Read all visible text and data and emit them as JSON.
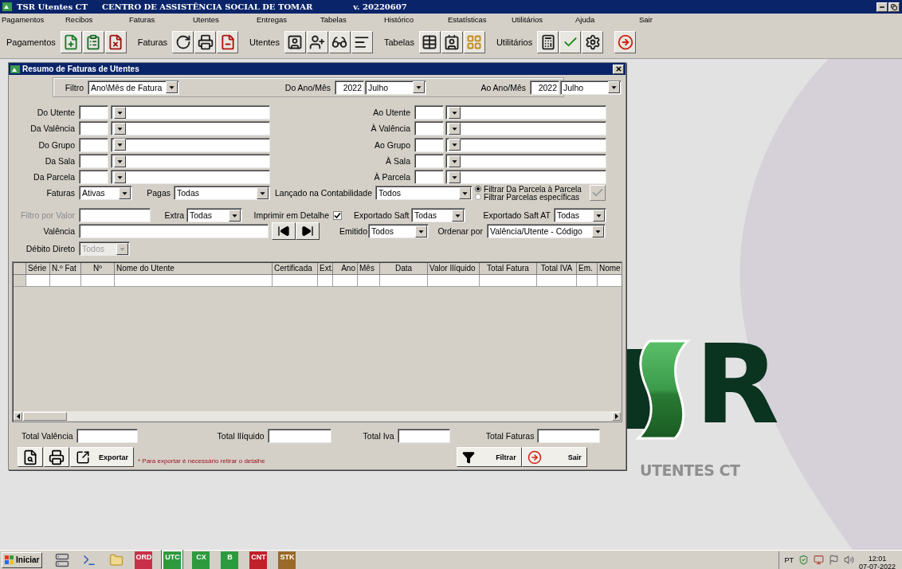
{
  "title_bar": {
    "app": "TSR Utentes CT",
    "organization": "CENTRO DE ASSISTÊNCIA SOCIAL DE TOMAR",
    "version": "v. 20220607"
  },
  "menu": [
    "Pagamentos",
    "Recibos",
    "Faturas",
    "Utentes",
    "Entregas",
    "Tabelas",
    "Histórico",
    "Estatísticas",
    "Utilitários",
    "Ajuda",
    "Sair"
  ],
  "toolbar": [
    {
      "label": "Pagamentos",
      "buttons": [
        {
          "kind": "new-doc"
        },
        {
          "kind": "checklist"
        },
        {
          "kind": "cancel-doc"
        }
      ]
    },
    {
      "label": "Faturas",
      "buttons": [
        {
          "kind": "refresh"
        },
        {
          "kind": "print"
        },
        {
          "kind": "void-doc"
        }
      ]
    },
    {
      "label": "Utentes",
      "buttons": [
        {
          "kind": "user-card"
        },
        {
          "kind": "user-add"
        },
        {
          "kind": "glasses"
        },
        {
          "kind": "list"
        }
      ]
    },
    {
      "label": "Tabelas",
      "buttons": [
        {
          "kind": "table"
        },
        {
          "kind": "users"
        },
        {
          "kind": "grid"
        }
      ]
    },
    {
      "label": "Utilitários",
      "buttons": [
        {
          "kind": "calculator"
        },
        {
          "kind": "check"
        },
        {
          "kind": "settings"
        }
      ]
    },
    {
      "buttons": [
        {
          "kind": "exit"
        }
      ]
    }
  ],
  "dialog": {
    "title": "Resumo de Faturas de Utentes",
    "period": {
      "filter_label": "Filtro",
      "filter_value": "Ano\\Mês de Fatura",
      "from_label": "Do Ano/Mês",
      "from_year": "2022",
      "from_month": "Julho",
      "to_label": "Ao Ano/Mês",
      "to_year": "2022",
      "to_month": "Julho"
    },
    "ranges": [
      {
        "from_label": "Do Utente",
        "to_label": "Ao Utente"
      },
      {
        "from_label": "Da Valência",
        "to_label": "À Valência"
      },
      {
        "from_label": "Do Grupo",
        "to_label": "Ao Grupo"
      },
      {
        "from_label": "Da Sala",
        "to_label": "À Sala"
      },
      {
        "from_label": "Da Parcela",
        "to_label": "À Parcela"
      }
    ],
    "faturas": {
      "label": "Faturas",
      "value": "Ativas"
    },
    "pagas": {
      "label": "Pagas",
      "value": "Todas"
    },
    "contabilidade": {
      "label": "Lançado na Contabilidade",
      "value": "Todos"
    },
    "parcel_mode": [
      {
        "label": "Filtrar Da Parcela à Parcela",
        "selected": true
      },
      {
        "label": "Filtrar Parcelas específicas",
        "selected": false
      }
    ],
    "apply_button": {
      "disabled": true
    },
    "valor": {
      "label": "Filtro por Valor",
      "disabled": true
    },
    "extra": {
      "label": "Extra",
      "value": "Todas"
    },
    "detalhe": {
      "label": "Imprimir em Detalhe",
      "checked": true
    },
    "saft": {
      "label": "Exportado Saft",
      "value": "Todas"
    },
    "saft_at": {
      "label": "Exportado Saft AT",
      "value": "Todas"
    },
    "valencia": {
      "label": "Valência"
    },
    "emitido": {
      "label": "Emitido",
      "value": "Todos"
    },
    "ordenar": {
      "label": "Ordenar por",
      "value": "Valência/Utente - Código"
    },
    "debito": {
      "label": "Débito Direto",
      "value": "Todos",
      "disabled": true
    },
    "table": {
      "columns": [
        "Série",
        "N.º Fat",
        "Nº",
        "Nome do Utente",
        "Certificada",
        "Ext.",
        "Ano",
        "Mês",
        "Data",
        "Valor Ilíquido",
        "Total Fatura",
        "Total IVA",
        "Em.",
        "Nome"
      ]
    },
    "totals": [
      {
        "label": "Total Valência"
      },
      {
        "label": "Total Ilíquido"
      },
      {
        "label": "Total Iva"
      },
      {
        "label": "Total Faturas"
      }
    ],
    "actions": {
      "export": "Exportar",
      "note": "* Para exportar é necessário retirar o detalhe",
      "filter": "Filtrar",
      "exit": "Sair"
    }
  },
  "logo": {
    "right": "R",
    "caption": "UTENTES CT"
  },
  "taskbar": {
    "start": "Iniciar",
    "apps": [
      {
        "label": "ORD",
        "color": "#c8304a",
        "selected": false
      },
      {
        "label": "UTC",
        "color": "#2e9a3e",
        "selected": true
      },
      {
        "label": "CX",
        "color": "#2e9a3e",
        "selected": false
      },
      {
        "label": "B",
        "color": "#2e9a3e",
        "selected": false
      },
      {
        "label": "CNT",
        "color": "#c0202a",
        "selected": false
      },
      {
        "label": "STK",
        "color": "#9a6a2a",
        "selected": false
      }
    ],
    "language": "PT",
    "time": "12:01",
    "date": "07-07-2022"
  }
}
